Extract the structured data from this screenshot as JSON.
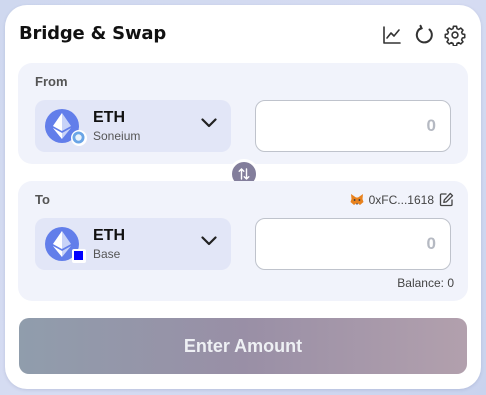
{
  "header": {
    "title": "Bridge & Swap",
    "icons": [
      "chart-icon",
      "refresh-icon",
      "settings-icon"
    ]
  },
  "from": {
    "label": "From",
    "token_symbol": "ETH",
    "chain": "Soneium",
    "amount_placeholder": "0"
  },
  "to": {
    "label": "To",
    "token_symbol": "ETH",
    "chain": "Base",
    "amount_placeholder": "0",
    "wallet_address": "0xFC...1618",
    "balance": "Balance: 0"
  },
  "cta": {
    "label": "Enter Amount"
  },
  "colors": {
    "eth": "#627eea",
    "base": "#0000ff",
    "soneium": "#6aa5e6"
  }
}
